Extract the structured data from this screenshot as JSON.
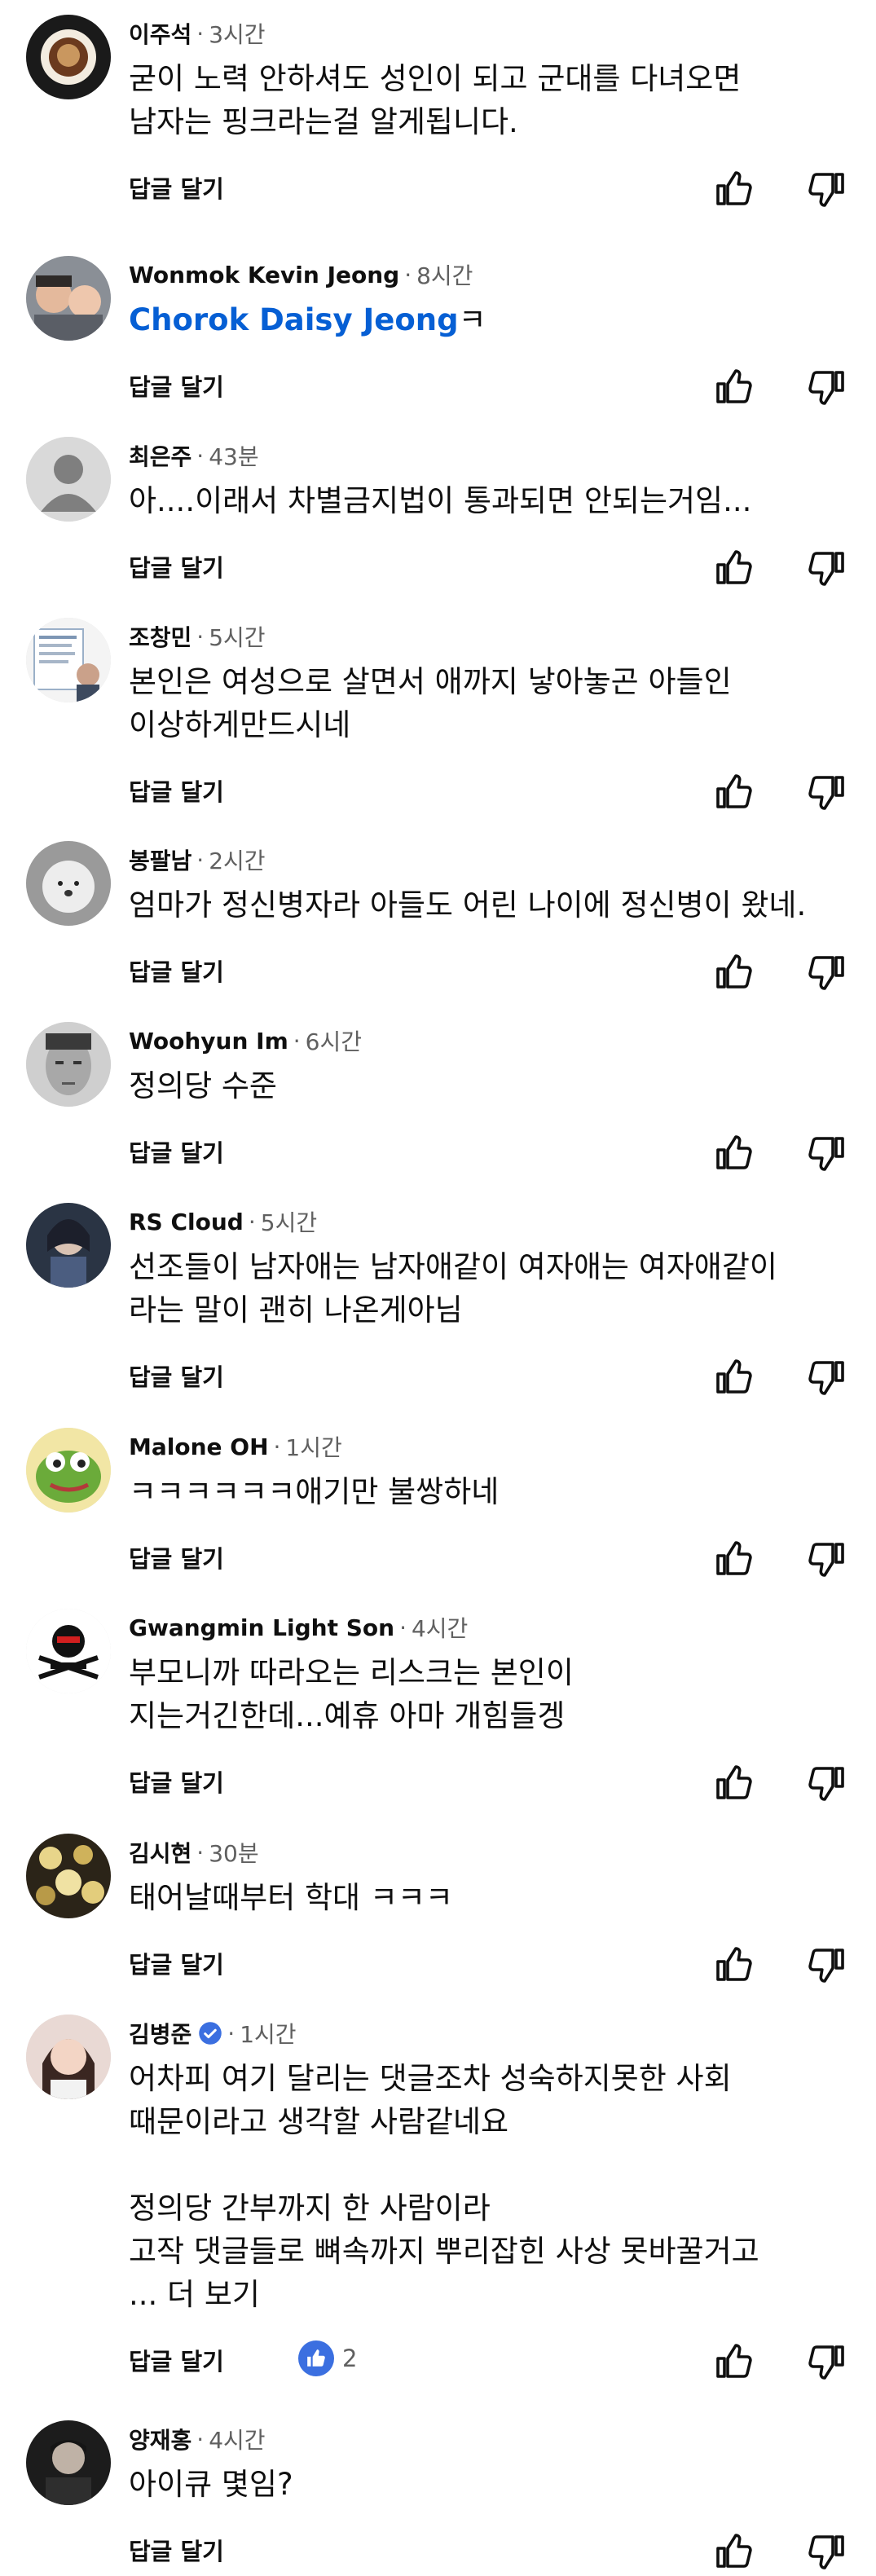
{
  "ui": {
    "reply_label": "답글 달기"
  },
  "comments": [
    {
      "author": "이주석",
      "time": "3시간",
      "text": "굳이 노력 안하셔도 성인이 되고 군대를 다녀오면\n남자는 핑크라는걸 알게됩니다.",
      "avatar": "avatar-coffee"
    },
    {
      "author": "Wonmok Kevin Jeong",
      "time": "8시간",
      "mention": "Chorok Daisy Jeong",
      "text": "ㅋ",
      "avatar": "avatar-family"
    },
    {
      "author": "최은주",
      "time": "43분",
      "text": "아....이래서 차별금지법이 통과되면 안되는거임...",
      "avatar": "avatar-default"
    },
    {
      "author": "조창민",
      "time": "5시간",
      "text": "본인은 여성으로 살면서 애까지 낳아놓곤 아들인\n이상하게만드시네",
      "avatar": "avatar-document"
    },
    {
      "author": "봉팔남",
      "time": "2시간",
      "text": "엄마가 정신병자라 아들도 어린 나이에 정신병이 왔네.",
      "avatar": "avatar-dog"
    },
    {
      "author": "Woohyun Im",
      "time": "6시간",
      "text": "정의당 수준",
      "avatar": "avatar-face"
    },
    {
      "author": "RS Cloud",
      "time": "5시간",
      "text": "선조들이 남자애는 남자애같이 여자애는 여자애같이\n라는 말이 괜히 나온게아님",
      "avatar": "avatar-character"
    },
    {
      "author": "Malone OH",
      "time": "1시간",
      "text": "ㅋㅋㅋㅋㅋㅋ애기만 불쌍하네",
      "avatar": "avatar-frog"
    },
    {
      "author": "Gwangmin Light Son",
      "time": "4시간",
      "text": "부모니까 따라오는 리스크는 본인이\n지는거긴한데...예휴 아마 개힘들겡",
      "avatar": "avatar-emblem"
    },
    {
      "author": "김시현",
      "time": "30분",
      "text": "태어날때부터 학대 ㅋㅋㅋ",
      "avatar": "avatar-flowers"
    },
    {
      "author": "김병준",
      "time": "1시간",
      "verified": true,
      "text": "어차피 여기 달리는 댓글조차 성숙하지못한 사회\n때문이라고 생각할 사람같네요\n\n정의당 간부까지 한 사람이라\n고작 댓글들로 뼈속까지 뿌리잡힌 사상 못바꿀거고\n... 더 보기",
      "likes": "2",
      "avatar": "avatar-girl"
    },
    {
      "author": "양재홍",
      "time": "4시간",
      "text": "아이큐 몇임?",
      "avatar": "avatar-man"
    }
  ]
}
